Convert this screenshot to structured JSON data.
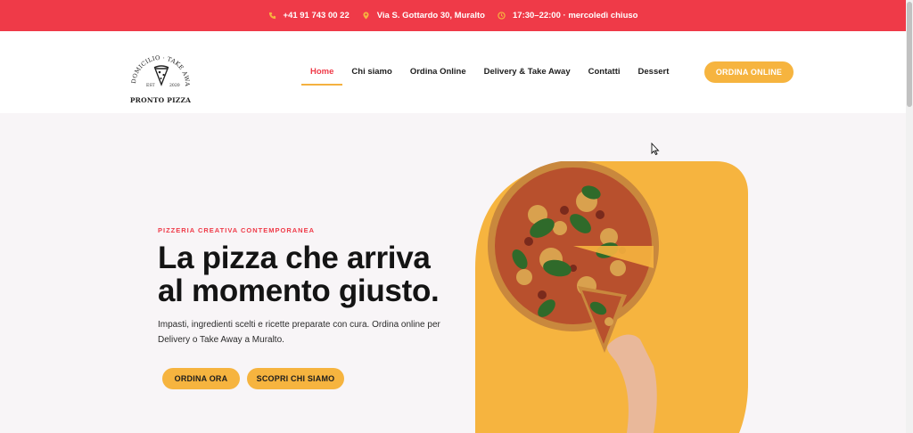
{
  "topbar": {
    "phone": "+41 91 743 00 22",
    "address": "Via S. Gottardo 30, Muralto",
    "hours": "17:30–22:00 · mercoledì chiuso",
    "icons": [
      "phone-icon",
      "location-pin-icon",
      "clock-icon"
    ],
    "background_color": "#ef3a48"
  },
  "logo": {
    "arc_text": "A DOMICILIO · TAKE AWAY",
    "year_left": "EST",
    "year_right": "2020",
    "name": "PRONTO PIZZA"
  },
  "nav": {
    "items": [
      {
        "label": "Home",
        "active": true
      },
      {
        "label": "Chi siamo",
        "active": false
      },
      {
        "label": "Ordina Online",
        "active": false
      },
      {
        "label": "Delivery & Take Away",
        "active": false
      },
      {
        "label": "Contatti",
        "active": false
      },
      {
        "label": "Dessert",
        "active": false
      }
    ],
    "cta": "ORDINA ONLINE"
  },
  "hero": {
    "eyebrow": "PIZZERIA CREATIVA CONTEMPORANEA",
    "headline_line1": "La pizza che arriva",
    "headline_line2": "al momento giusto.",
    "lead_line1": "Impasti, ingredienti scelti e ricette preparate con cura. Ordina online per",
    "lead_line2": "Delivery o Take Away a Muralto.",
    "primary_button": "ORDINA ORA",
    "secondary_button": "SCOPRI CHI SIAMO"
  },
  "colors": {
    "accent_red": "#ef3a48",
    "accent_yellow": "#f6b43f",
    "hero_background": "#f8f5f7"
  }
}
